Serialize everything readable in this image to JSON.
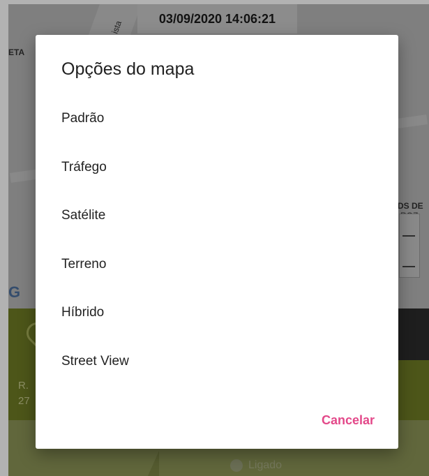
{
  "map": {
    "timestamp": "03/09/2020 14:06:21",
    "labels": {
      "left": "ETA",
      "right_1": "DS DE",
      "right_2": "ROZ",
      "google": "G",
      "street_vert": "ista"
    }
  },
  "info": {
    "address_1": "R.",
    "address_2": "27",
    "status": "Ligado"
  },
  "dialog": {
    "title": "Opções do mapa",
    "options": [
      "Padrão",
      "Tráfego",
      "Satélite",
      "Terreno",
      "Híbrido",
      "Street View"
    ],
    "cancel_label": "Cancelar",
    "accent": "#e34889"
  },
  "colors": {
    "map_bg": "#b7b7b7",
    "green_band": "#6f7b25",
    "lower_band": "#8b9457"
  }
}
